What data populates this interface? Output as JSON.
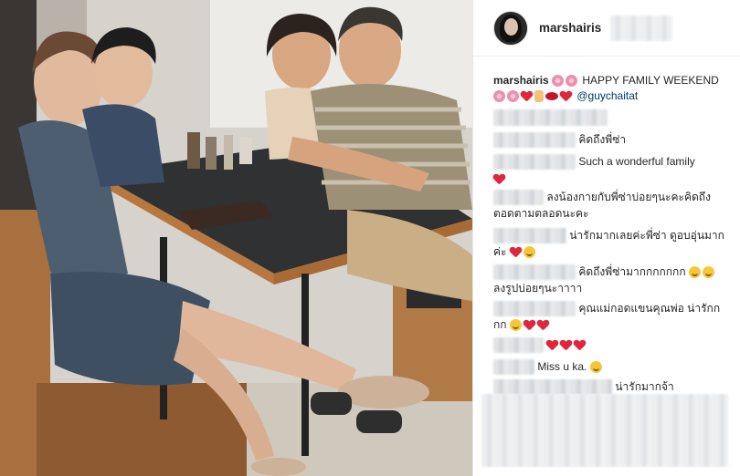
{
  "post": {
    "username": "marshairis",
    "caption_text": "HAPPY FAMILY WEEKEND",
    "caption_mention": "@guychaitat"
  },
  "comments": [
    {
      "text": "คิดถึงพี่ซ่า"
    },
    {
      "text": "Such a wonderful family"
    },
    {
      "text": "ลงน้องกายกับพี่ซ่าบ่อยๆนะคะคิดถึง"
    },
    {
      "text": "ตอดตามตลอดนะคะ"
    },
    {
      "text": "น่ารักมากเลยค่ะพี่ซ่า ดูอบอุ่นมาก"
    },
    {
      "text": "ค่ะ"
    },
    {
      "text": "คิดถึงพี่ซ่ามากกกกกกก"
    },
    {
      "text": "ลงรูปบ่อยๆนะาาาา"
    },
    {
      "text": "คุณแม่กอดแขนคุณพ่อ น่ารักก"
    },
    {
      "text": "กก"
    },
    {
      "text": "Miss u ka."
    },
    {
      "text": "น่ารักมากจ้า"
    }
  ],
  "icons": {
    "flower": "cherry-blossom-icon",
    "heart": "red-heart-icon",
    "lips": "kiss-lips-icon",
    "hand": "hand-sign-icon",
    "smile": "smiling-face-icon"
  },
  "colors": {
    "heart": "#e0263c",
    "link": "#003569",
    "text": "#262626"
  }
}
